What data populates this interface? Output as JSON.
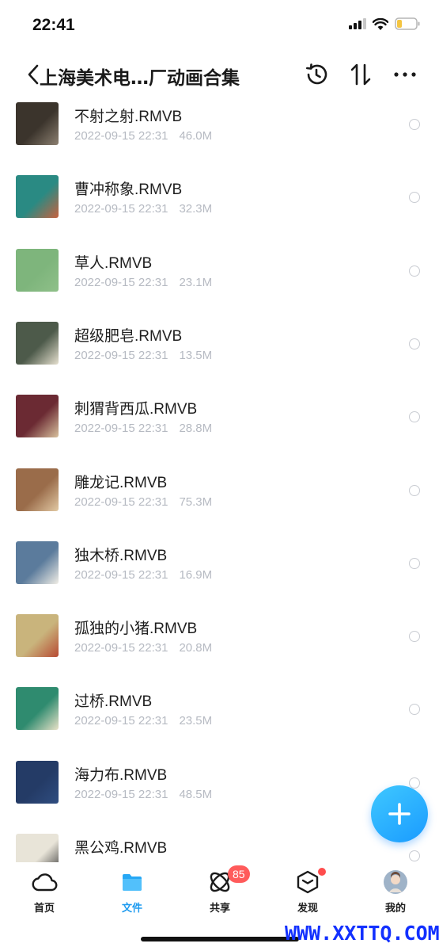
{
  "status_bar": {
    "time": "22:41"
  },
  "header": {
    "title": "上海美术电…厂动画合集"
  },
  "files": [
    {
      "name": "不射之射.RMVB",
      "date": "2022-09-15 22:31",
      "size": "46.0M",
      "thumb_colors": [
        "#3b342c",
        "#8c8071"
      ]
    },
    {
      "name": "曹冲称象.RMVB",
      "date": "2022-09-15 22:31",
      "size": "32.3M",
      "thumb_colors": [
        "#2a8a83",
        "#c7623f"
      ]
    },
    {
      "name": "草人.RMVB",
      "date": "2022-09-15 22:31",
      "size": "23.1M",
      "thumb_colors": [
        "#7eb57c",
        "#8fc089"
      ]
    },
    {
      "name": "超级肥皂.RMVB",
      "date": "2022-09-15 22:31",
      "size": "13.5M",
      "thumb_colors": [
        "#4d5a4a",
        "#e6e0cf"
      ]
    },
    {
      "name": "刺猬背西瓜.RMVB",
      "date": "2022-09-15 22:31",
      "size": "28.8M",
      "thumb_colors": [
        "#6b2a33",
        "#d8c19e"
      ]
    },
    {
      "name": "雕龙记.RMVB",
      "date": "2022-09-15 22:31",
      "size": "75.3M",
      "thumb_colors": [
        "#9a6c4a",
        "#e2c9a4"
      ]
    },
    {
      "name": "独木桥.RMVB",
      "date": "2022-09-15 22:31",
      "size": "16.9M",
      "thumb_colors": [
        "#5b7b9c",
        "#f1eee6"
      ]
    },
    {
      "name": "孤独的小猪.RMVB",
      "date": "2022-09-15 22:31",
      "size": "20.8M",
      "thumb_colors": [
        "#c9b47c",
        "#b74a33"
      ]
    },
    {
      "name": "过桥.RMVB",
      "date": "2022-09-15 22:31",
      "size": "23.5M",
      "thumb_colors": [
        "#2f8b6f",
        "#e9e2c8"
      ]
    },
    {
      "name": "海力布.RMVB",
      "date": "2022-09-15 22:31",
      "size": "48.5M",
      "thumb_colors": [
        "#243b66",
        "#2f4d80"
      ]
    },
    {
      "name": "黑公鸡.RMVB",
      "date": "",
      "size": "",
      "thumb_colors": [
        "#e8e4d8",
        "#333333"
      ]
    }
  ],
  "tabs": [
    {
      "label": "首页",
      "icon": "cloud-icon"
    },
    {
      "label": "文件",
      "icon": "folder-icon"
    },
    {
      "label": "共享",
      "icon": "share-orbit-icon",
      "badge": "85"
    },
    {
      "label": "发现",
      "icon": "cube-icon"
    },
    {
      "label": "我的",
      "icon": "avatar"
    }
  ],
  "colors": {
    "accent": "#1e9bf0",
    "badge": "#ff5b5b",
    "meta_text": "#b6bac2"
  },
  "watermark": "WWW.XXTTQ.COM"
}
